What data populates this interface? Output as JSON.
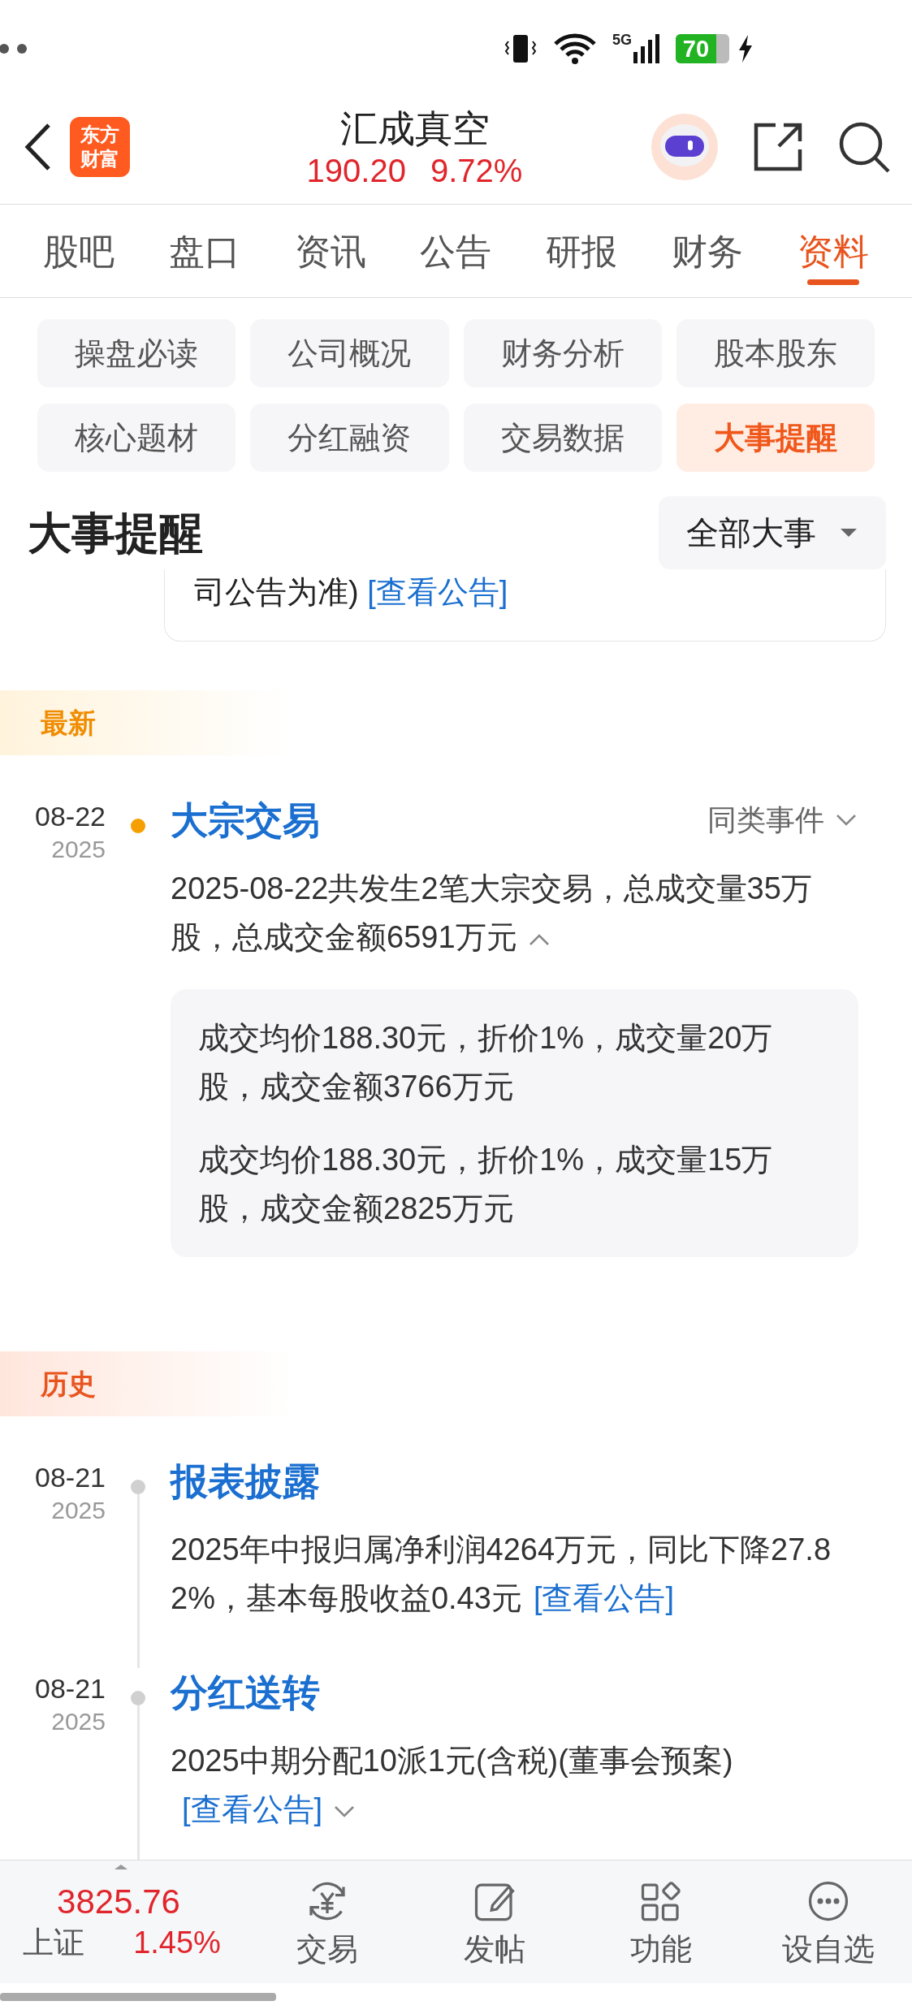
{
  "status_bar": {
    "network": "5G",
    "battery": "70"
  },
  "header": {
    "logo": "东方财富",
    "title": "汇成真空",
    "price": "190.20",
    "change": "9.72%"
  },
  "tabs": [
    {
      "label": "股吧",
      "selected": false
    },
    {
      "label": "盘口",
      "selected": false
    },
    {
      "label": "资讯",
      "selected": false
    },
    {
      "label": "公告",
      "selected": false
    },
    {
      "label": "研报",
      "selected": false
    },
    {
      "label": "财务",
      "selected": false
    },
    {
      "label": "资料",
      "selected": true
    }
  ],
  "sections": [
    {
      "label": "操盘必读",
      "selected": false
    },
    {
      "label": "公司概况",
      "selected": false
    },
    {
      "label": "财务分析",
      "selected": false
    },
    {
      "label": "股本股东",
      "selected": false
    },
    {
      "label": "核心题材",
      "selected": false
    },
    {
      "label": "分红融资",
      "selected": false
    },
    {
      "label": "交易数据",
      "selected": false
    },
    {
      "label": "大事提醒",
      "selected": true
    }
  ],
  "page_title": "大事提醒",
  "filter": {
    "label": "全部大事"
  },
  "previous_card": {
    "text": "司公告为准)",
    "link": "[查看公告]"
  },
  "groups": [
    {
      "kind": "latest",
      "label": "最新",
      "events": [
        {
          "date": "08-22",
          "year": "2025",
          "title": "大宗交易",
          "action": "同类事件",
          "summary": "2025-08-22共发生2笔大宗交易，总成交量35万股，总成交金额6591万元",
          "expanded": true,
          "details": [
            "成交均价188.30元，折价1%，成交量20万股，成交金额3766万元",
            "成交均价188.30元，折价1%，成交量15万股，成交金额2825万元"
          ]
        }
      ]
    },
    {
      "kind": "history",
      "label": "历史",
      "events": [
        {
          "date": "08-21",
          "year": "2025",
          "title": "报表披露",
          "summary": "2025年中报归属净利润4264万元，同比下降27.82%，基本每股收益0.43元",
          "link": "[查看公告]"
        },
        {
          "date": "08-21",
          "year": "2025",
          "title": "分红送转",
          "summary": "2025中期分配10派1元(含税)(董事会预案)",
          "link": "[查看公告]",
          "expanded": false
        }
      ]
    }
  ],
  "bottom_bar": {
    "index": {
      "value": "3825.76",
      "name": "上证",
      "change": "1.45%"
    },
    "items": [
      {
        "kind": "trade",
        "label": "交易"
      },
      {
        "kind": "post",
        "label": "发帖"
      },
      {
        "kind": "functions",
        "label": "功能"
      },
      {
        "kind": "watchlist",
        "label": "设自选"
      }
    ]
  }
}
